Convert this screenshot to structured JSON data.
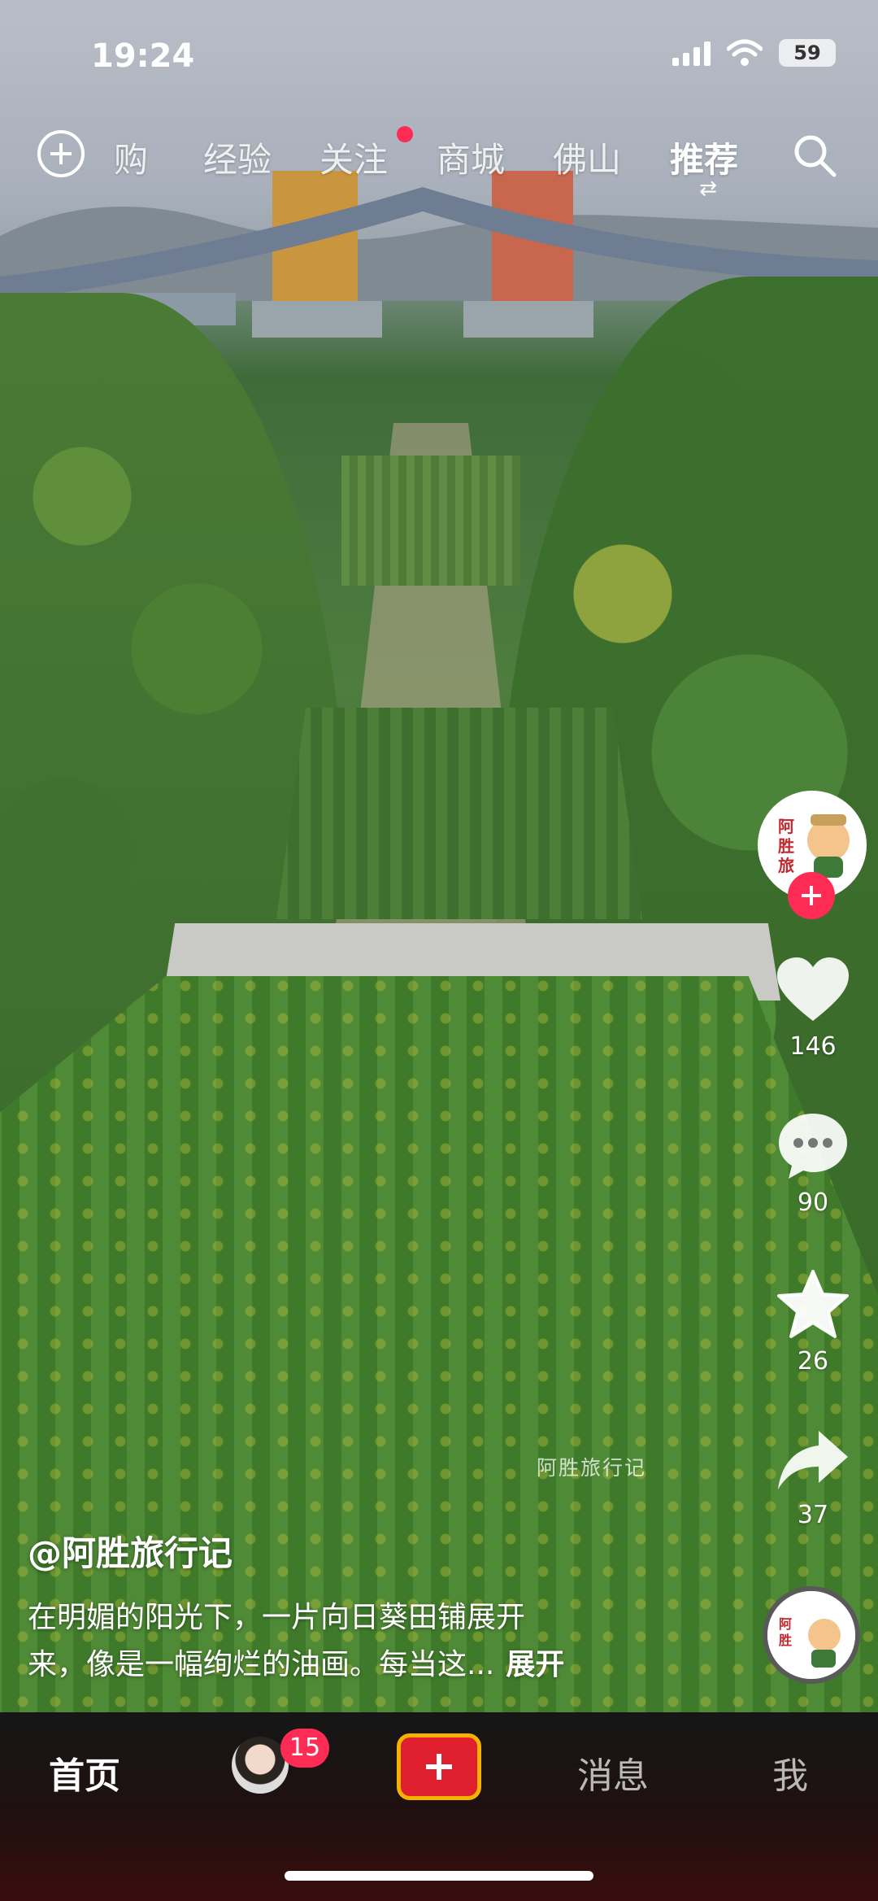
{
  "status_bar": {
    "time": "19:24",
    "battery": "59"
  },
  "top_nav": {
    "tabs": [
      {
        "label": "购"
      },
      {
        "label": "经验"
      },
      {
        "label": "关注"
      },
      {
        "label": "商城"
      },
      {
        "label": "佛山"
      },
      {
        "label": "推荐"
      }
    ],
    "active_tab": "推荐"
  },
  "video": {
    "watermark": "阿胜旅行记"
  },
  "rail": {
    "likes": "146",
    "comments": "90",
    "favorites": "26",
    "shares": "37"
  },
  "caption": {
    "author": "@阿胜旅行记",
    "line1": "在明媚的阳光下，一片向日葵田铺展开",
    "line2": "来，像是一幅绚烂的油画。每当这...",
    "expand": "展开"
  },
  "bottom_bar": {
    "home": "首页",
    "friends_badge": "15",
    "messages": "消息",
    "me": "我"
  },
  "colors": {
    "accent": "#fe2c55",
    "create_border": "#f5b200",
    "create_fill": "#e01f2e"
  }
}
